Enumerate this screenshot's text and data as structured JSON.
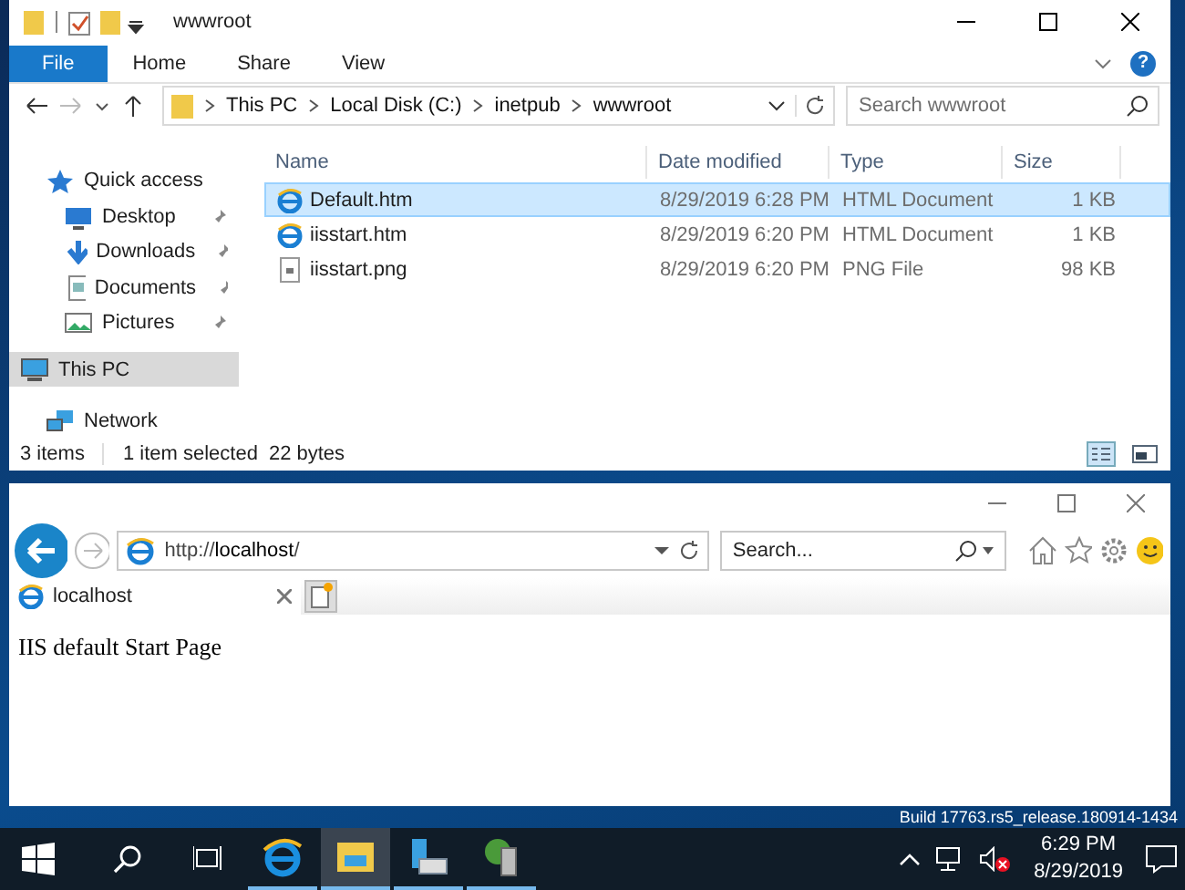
{
  "explorer": {
    "title": "wwwroot",
    "ribbon_tabs": [
      {
        "label": "File",
        "selected": true
      },
      {
        "label": "Home",
        "selected": false
      },
      {
        "label": "Share",
        "selected": false
      },
      {
        "label": "View",
        "selected": false
      }
    ],
    "help": "?",
    "breadcrumb": [
      "This PC",
      "Local Disk (C:)",
      "inetpub",
      "wwwroot"
    ],
    "search": {
      "placeholder": "Search wwwroot"
    },
    "nav": [
      {
        "label": "Quick access",
        "kind": "group",
        "pinned": false,
        "selected": false
      },
      {
        "label": "Desktop",
        "kind": "item",
        "pinned": true,
        "selected": false
      },
      {
        "label": "Downloads",
        "kind": "item",
        "pinned": true,
        "selected": false
      },
      {
        "label": "Documents",
        "kind": "item",
        "pinned": true,
        "selected": false
      },
      {
        "label": "Pictures",
        "kind": "item",
        "pinned": true,
        "selected": false
      },
      {
        "label": "This PC",
        "kind": "group",
        "pinned": false,
        "selected": true
      },
      {
        "label": "Network",
        "kind": "group",
        "pinned": false,
        "selected": false
      }
    ],
    "columns": [
      "Name",
      "Date modified",
      "Type",
      "Size"
    ],
    "files": [
      {
        "name": "Default.htm",
        "date": "8/29/2019 6:28 PM",
        "type": "HTML Document",
        "size": "1 KB",
        "kind": "html",
        "selected": true
      },
      {
        "name": "iisstart.htm",
        "date": "8/29/2019 6:20 PM",
        "type": "HTML Document",
        "size": "1 KB",
        "kind": "html",
        "selected": false
      },
      {
        "name": "iisstart.png",
        "date": "8/29/2019 6:20 PM",
        "type": "PNG File",
        "size": "98 KB",
        "kind": "png",
        "selected": false
      }
    ],
    "status": {
      "count": "3 items",
      "selection": "1 item selected",
      "bytes": "22 bytes"
    }
  },
  "browser": {
    "url": "http://**localhost**/",
    "search": {
      "placeholder": "Search..."
    },
    "tab": {
      "label": "localhost"
    },
    "page_text": "IIS default Start Page"
  },
  "desktop": {
    "build": "Build 17763.rs5_release.180914-1434"
  },
  "taskbar": {
    "apps": [
      {
        "selected": false
      },
      {
        "selected": true
      },
      {
        "selected": false
      },
      {
        "selected": false
      }
    ],
    "time": "6:29 PM",
    "date": "8/29/2019"
  }
}
